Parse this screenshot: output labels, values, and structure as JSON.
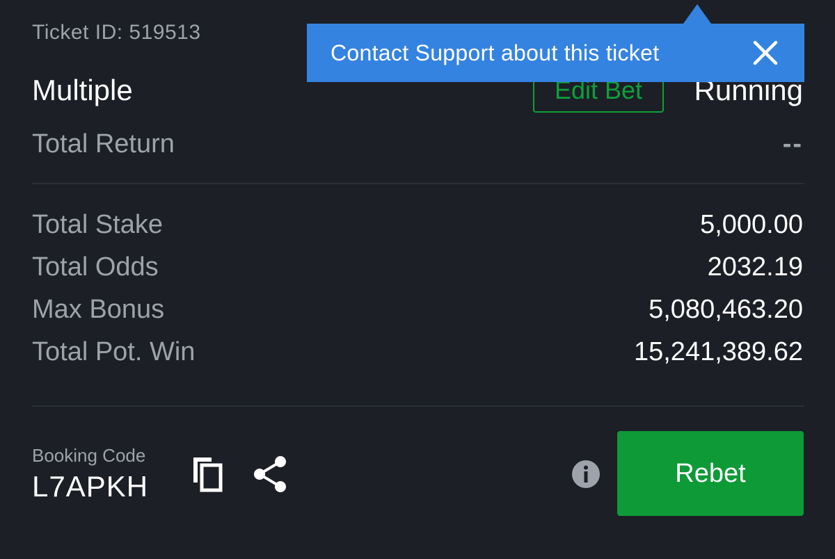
{
  "ticket": {
    "id_text": "Ticket ID: 519513",
    "bet_type": "Multiple",
    "edit_bet_label": "Edit Bet",
    "status": "Running",
    "total_return_label": "Total Return",
    "total_return_value": "--"
  },
  "summary": {
    "rows": [
      {
        "label": "Total Stake",
        "value": "5,000.00"
      },
      {
        "label": "Total Odds",
        "value": "2032.19"
      },
      {
        "label": "Max Bonus",
        "value": "5,080,463.20"
      },
      {
        "label": "Total Pot. Win",
        "value": "15,241,389.62"
      }
    ]
  },
  "booking": {
    "label": "Booking Code",
    "code": "L7APKH",
    "copy_icon": "copy-icon",
    "share_icon": "share-icon",
    "info_icon": "info-icon",
    "rebet_label": "Rebet"
  },
  "tooltip": {
    "text": "Contact Support about this ticket",
    "close_icon": "close-icon"
  },
  "colors": {
    "background": "#1c1f26",
    "accent_green": "#0e9a36",
    "tooltip_blue": "#3583e0",
    "muted_text": "#9ea3ab"
  }
}
